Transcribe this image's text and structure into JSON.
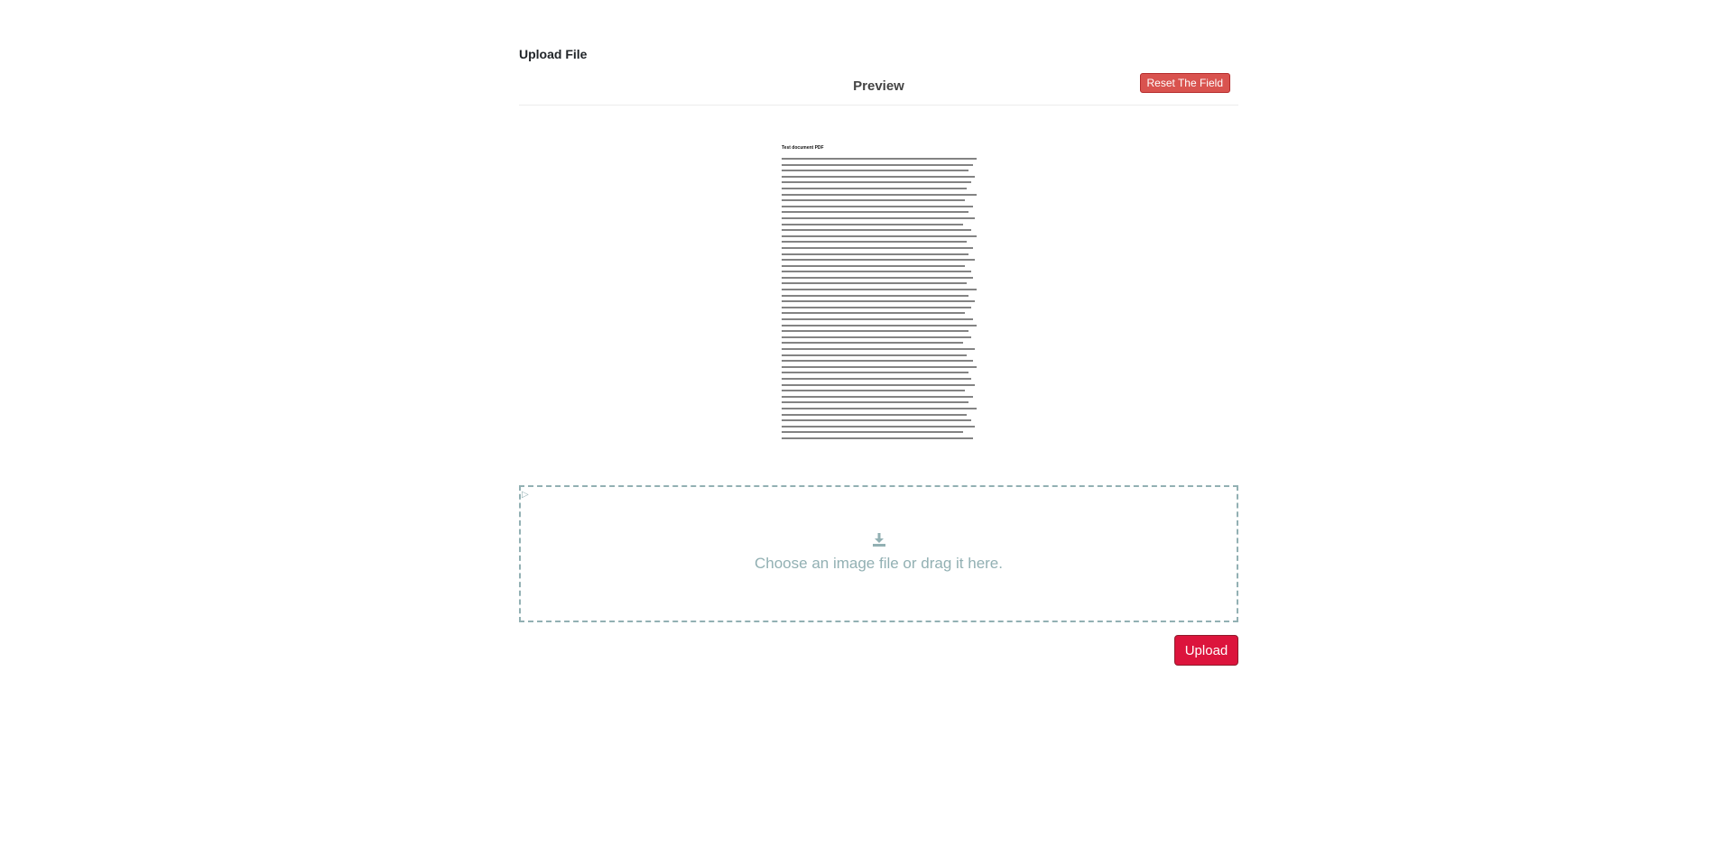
{
  "upload_section": {
    "title": "Upload File"
  },
  "preview": {
    "title": "Preview",
    "reset_label": "Reset The Field",
    "document_heading": "Test document PDF"
  },
  "dropzone": {
    "icon": "download-icon",
    "text": "Choose an image file or drag it here."
  },
  "actions": {
    "upload_label": "Upload"
  },
  "colors": {
    "reset_button": "#d9534f",
    "upload_button": "#dc143c",
    "dropzone_accent": "#92b0b3"
  }
}
